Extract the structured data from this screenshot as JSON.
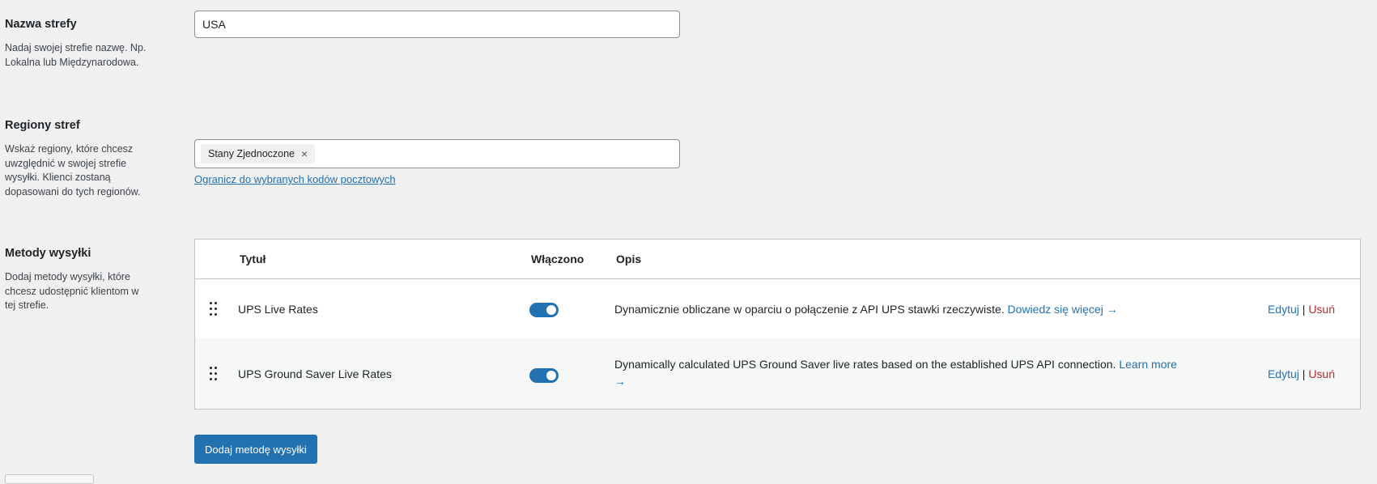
{
  "zone_name": {
    "title": "Nazwa strefy",
    "description": "Nadaj swojej strefie nazwę. Np. Lokalna lub Międzynarodowa.",
    "value": "USA"
  },
  "zone_regions": {
    "title": "Regiony stref",
    "description": "Wskaż regiony, które chcesz uwzględnić w swojej strefie wysyłki. Klienci zostaną dopasowani do tych regionów.",
    "selected": [
      "Stany Zjednoczone"
    ],
    "remove_glyph": "×",
    "postcode_link": "Ogranicz do wybranych kodów pocztowych"
  },
  "shipping_methods": {
    "title": "Metody wysyłki",
    "description": "Dodaj metody wysyłki, które chcesz udostępnić klientom w tej strefie.",
    "columns": {
      "title": "Tytuł",
      "enabled": "Włączono",
      "description": "Opis"
    },
    "rows": [
      {
        "title": "UPS Live Rates",
        "enabled": true,
        "description": "Dynamicznie obliczane w oparciu o połączenie z API UPS stawki rzeczywiste.",
        "learn_more": "Dowiedz się więcej →",
        "edit": "Edytuj",
        "separator": "|",
        "delete": "Usuń"
      },
      {
        "title": "UPS Ground Saver Live Rates",
        "enabled": true,
        "description": "Dynamically calculated UPS Ground Saver live rates based on the established UPS API connection.",
        "learn_more": "Learn more →",
        "edit": "Edytuj",
        "separator": "|",
        "delete": "Usuń"
      }
    ],
    "add_button": "Dodaj metodę wysyłki"
  },
  "colors": {
    "accent": "#2271b1",
    "danger": "#b32d2e",
    "background": "#f0f0f1"
  }
}
